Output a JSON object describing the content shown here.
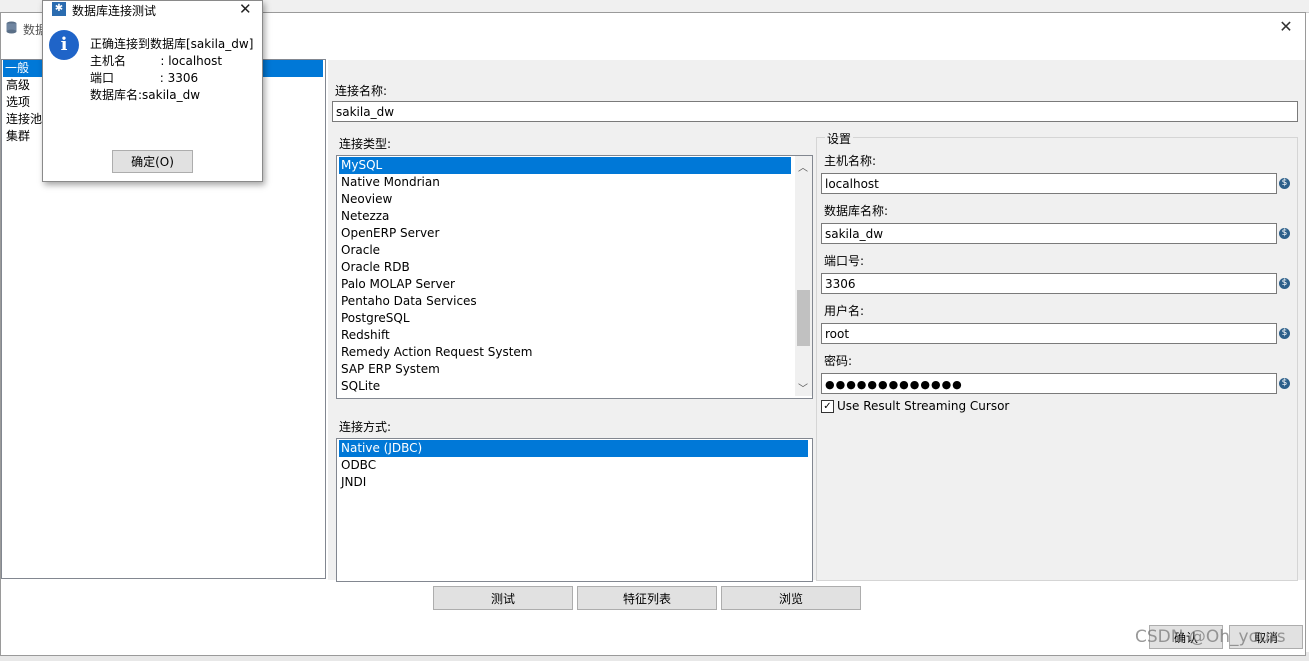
{
  "dialog": {
    "title_partial": "数据",
    "close_glyph": "✕"
  },
  "left_nav": {
    "items": [
      {
        "label": "一般",
        "selected": true
      },
      {
        "label": "高级",
        "selected": false
      },
      {
        "label": "选项",
        "selected": false
      },
      {
        "label": "连接池",
        "selected": false
      },
      {
        "label": "集群",
        "selected": false
      }
    ]
  },
  "general": {
    "connection_name_label": "连接名称:",
    "connection_name_value": "sakila_dw",
    "connection_type_label": "连接类型:",
    "connection_types": [
      {
        "label": "MySQL",
        "selected": true
      },
      {
        "label": "Native Mondrian",
        "selected": false
      },
      {
        "label": "Neoview",
        "selected": false
      },
      {
        "label": "Netezza",
        "selected": false
      },
      {
        "label": "OpenERP Server",
        "selected": false
      },
      {
        "label": "Oracle",
        "selected": false
      },
      {
        "label": "Oracle RDB",
        "selected": false
      },
      {
        "label": "Palo MOLAP Server",
        "selected": false
      },
      {
        "label": "Pentaho Data Services",
        "selected": false
      },
      {
        "label": "PostgreSQL",
        "selected": false
      },
      {
        "label": "Redshift",
        "selected": false
      },
      {
        "label": "Remedy Action Request System",
        "selected": false
      },
      {
        "label": "SAP ERP System",
        "selected": false
      },
      {
        "label": "SQLite",
        "selected": false
      }
    ],
    "access_label": "连接方式:",
    "access_types": [
      {
        "label": "Native (JDBC)",
        "selected": true
      },
      {
        "label": "ODBC",
        "selected": false
      },
      {
        "label": "JNDI",
        "selected": false
      }
    ]
  },
  "settings": {
    "group_label": "设置",
    "host_label": "主机名称:",
    "host_value": "localhost",
    "db_label": "数据库名称:",
    "db_value": "sakila_dw",
    "port_label": "端口号:",
    "port_value": "3306",
    "user_label": "用户名:",
    "user_value": "root",
    "password_label": "密码:",
    "password_value": "●●●●●●●●●●●●●",
    "streaming_cursor_label": "Use Result Streaming Cursor",
    "streaming_cursor_checked": true,
    "variable_icon_glyph": "$"
  },
  "buttons": {
    "test": "测试",
    "feature_list": "特征列表",
    "browse": "浏览",
    "ok": "确认",
    "cancel": "取消"
  },
  "popup": {
    "title": "数据库连接测试",
    "close_glyph": "✕",
    "line1": "正确连接到数据库[sakila_dw]",
    "line2": "主机名         : localhost",
    "line3": "端口            : 3306",
    "line4": "数据库名:sakila_dw",
    "ok_label": "确定(O)"
  },
  "watermark": "CSDN @Oh_yours"
}
